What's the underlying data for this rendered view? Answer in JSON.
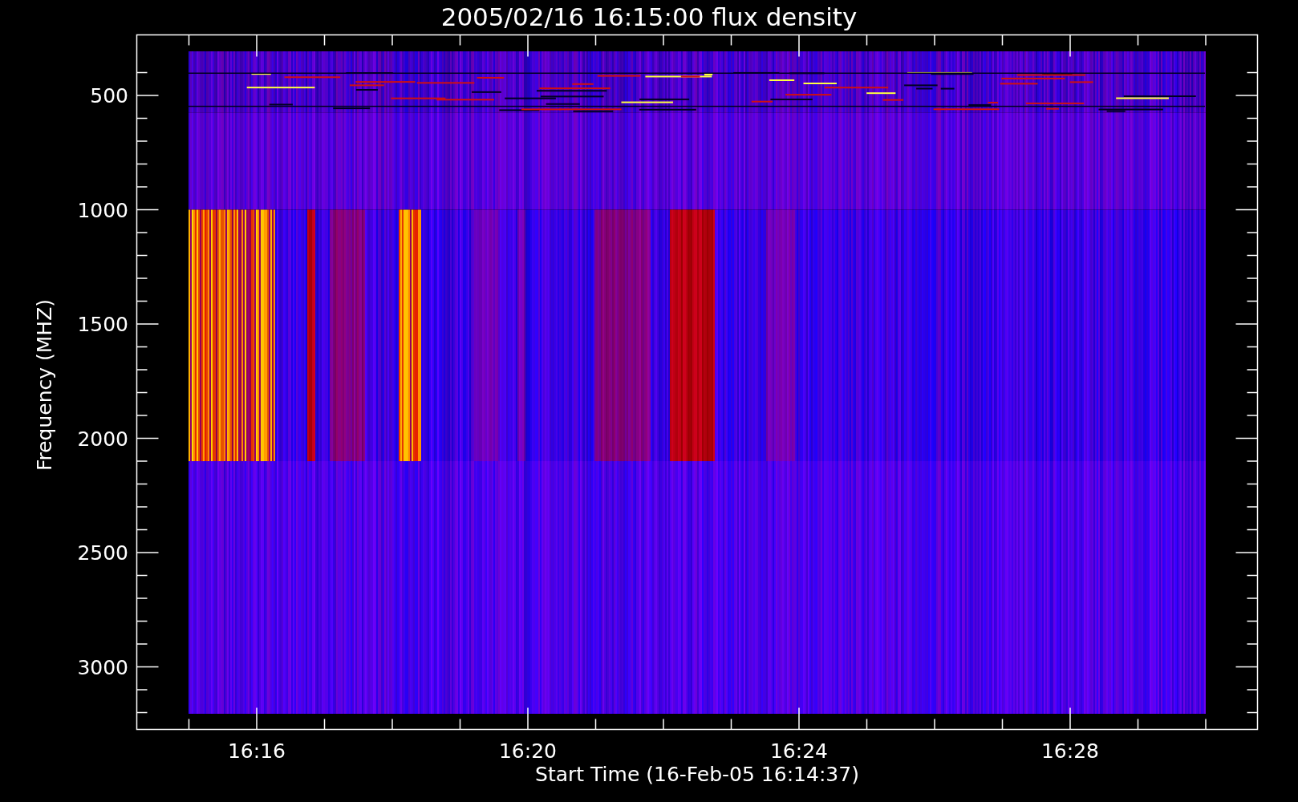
{
  "title": "2005/02/16 16:15:00 flux density",
  "y_axis": {
    "label": "Frequency (MHZ)",
    "ticks": [
      "500",
      "1000",
      "1500",
      "2000",
      "2500",
      "3000"
    ]
  },
  "x_axis": {
    "label": "Start Time (16-Feb-05 16:14:37)",
    "ticks": [
      "16:16",
      "16:20",
      "16:24",
      "16:28"
    ]
  }
}
